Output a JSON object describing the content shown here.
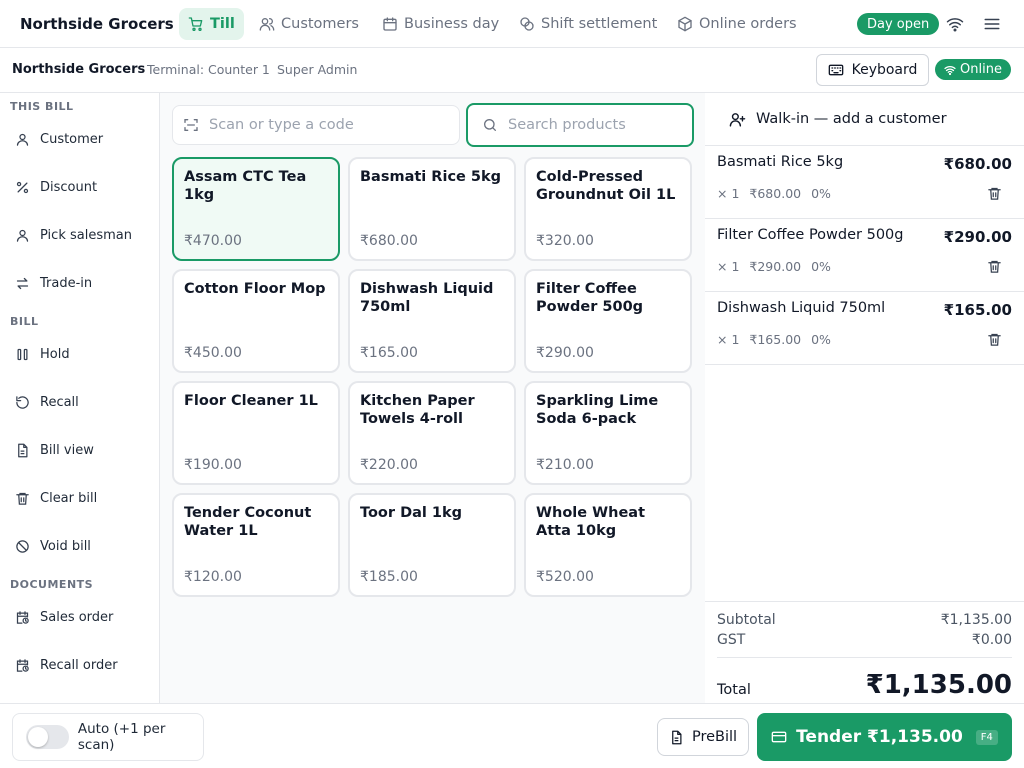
{
  "brand": "Northside Grocers",
  "nav": {
    "tabs": [
      {
        "label": "Till",
        "icon": "cart-icon",
        "active": true
      },
      {
        "label": "Customers",
        "icon": "users-icon"
      },
      {
        "label": "Business day",
        "icon": "calendar-icon"
      },
      {
        "label": "Shift settlement",
        "icon": "coins-icon"
      },
      {
        "label": "Online orders",
        "icon": "package-icon"
      }
    ],
    "day_status": "Day open"
  },
  "subheader": {
    "store": "Northside Grocers",
    "terminal": "Terminal: Counter 1",
    "user": "Super Admin",
    "keyboard_label": "Keyboard",
    "online_label": "Online"
  },
  "sidebar": {
    "this_bill_title": "THIS BILL",
    "bill_title": "BILL",
    "documents_title": "DOCUMENTS",
    "items": [
      {
        "label": "Customer",
        "icon": "user-icon"
      },
      {
        "label": "Discount",
        "icon": "percent-icon"
      },
      {
        "label": "Pick salesman",
        "icon": "user-icon"
      },
      {
        "label": "Trade-in",
        "icon": "swap-icon"
      },
      {
        "label": "Hold",
        "icon": "pause-icon"
      },
      {
        "label": "Recall",
        "icon": "undo-icon"
      },
      {
        "label": "Bill view",
        "icon": "file-icon"
      },
      {
        "label": "Clear bill",
        "icon": "trash-icon"
      },
      {
        "label": "Void bill",
        "icon": "ban-icon"
      },
      {
        "label": "Sales order",
        "icon": "calendar-clock-icon"
      },
      {
        "label": "Recall order",
        "icon": "calendar-clock-icon"
      }
    ]
  },
  "search": {
    "scan_placeholder": "Scan or type a code",
    "product_placeholder": "Search products"
  },
  "products": [
    {
      "name": "Assam CTC Tea 1kg",
      "price": "₹470.00",
      "selected": true
    },
    {
      "name": "Basmati Rice 5kg",
      "price": "₹680.00"
    },
    {
      "name": "Cold-Pressed Groundnut Oil 1L",
      "price": "₹320.00"
    },
    {
      "name": "Cotton Floor Mop",
      "price": "₹450.00"
    },
    {
      "name": "Dishwash Liquid 750ml",
      "price": "₹165.00"
    },
    {
      "name": "Filter Coffee Powder 500g",
      "price": "₹290.00"
    },
    {
      "name": "Floor Cleaner 1L",
      "price": "₹190.00"
    },
    {
      "name": "Kitchen Paper Towels 4-roll",
      "price": "₹220.00"
    },
    {
      "name": "Sparkling Lime Soda 6-pack",
      "price": "₹210.00"
    },
    {
      "name": "Tender Coconut Water 1L",
      "price": "₹120.00"
    },
    {
      "name": "Toor Dal 1kg",
      "price": "₹185.00"
    },
    {
      "name": "Whole Wheat Atta 10kg",
      "price": "₹520.00"
    }
  ],
  "cart": {
    "customer_label": "Walk-in — add a customer",
    "lines": [
      {
        "name": "Basmati Rice 5kg",
        "total": "₹680.00",
        "qty": "× 1",
        "unit": "₹680.00",
        "discount": "0%"
      },
      {
        "name": "Filter Coffee Powder 500g",
        "total": "₹290.00",
        "qty": "× 1",
        "unit": "₹290.00",
        "discount": "0%"
      },
      {
        "name": "Dishwash Liquid 750ml",
        "total": "₹165.00",
        "qty": "× 1",
        "unit": "₹165.00",
        "discount": "0%"
      }
    ],
    "subtotal_label": "Subtotal",
    "subtotal": "₹1,135.00",
    "gst_label": "GST",
    "gst": "₹0.00",
    "total_label": "Total",
    "total": "₹1,135.00"
  },
  "footer": {
    "auto_label": "Auto (+1 per scan)",
    "auto_on": false,
    "prebill_label": "PreBill",
    "tender_label": "Tender ₹1,135.00",
    "tender_shortcut": "F4"
  },
  "colors": {
    "accent": "#1a9a66",
    "accent_light": "#e3f4ec"
  }
}
